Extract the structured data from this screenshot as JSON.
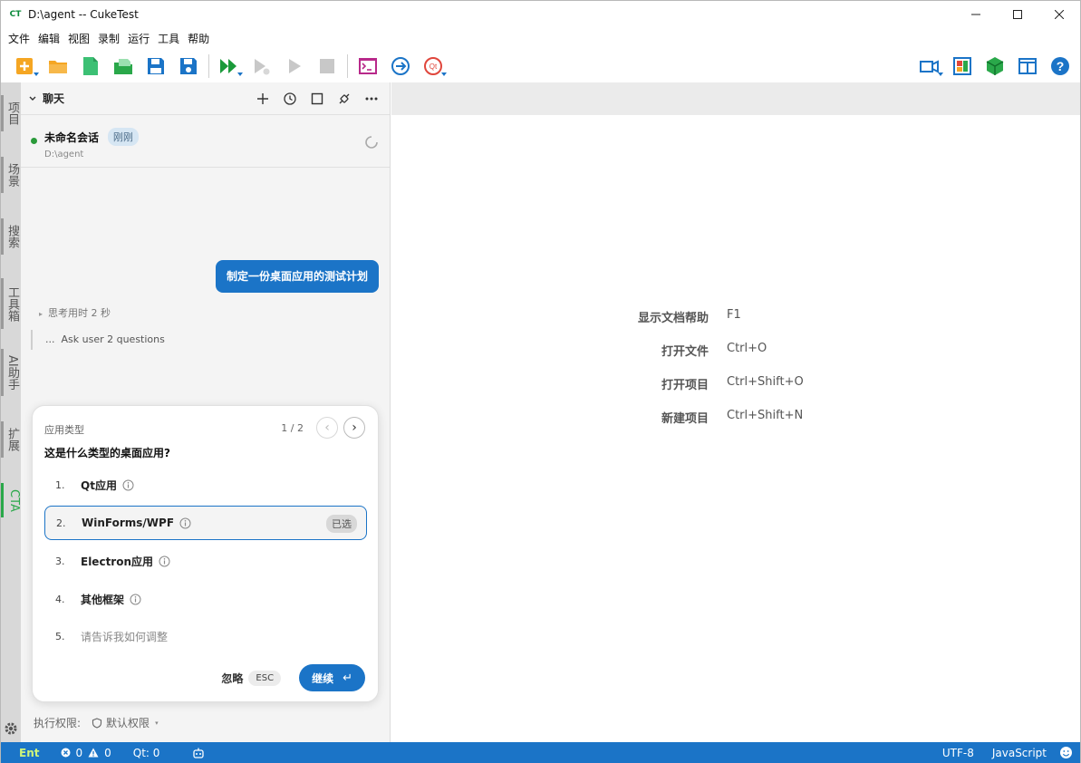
{
  "window": {
    "logo_text": "CT",
    "title": "D:\\agent -- CukeTest"
  },
  "menu": [
    "文件",
    "编辑",
    "视图",
    "录制",
    "运行",
    "工具",
    "帮助"
  ],
  "toolbar": {
    "icons": [
      "new-icon",
      "open-folder-icon",
      "new-file-icon",
      "open-file-icon",
      "save-icon",
      "save-all-icon",
      "run-all-icon",
      "run-config-icon",
      "run-icon",
      "stop-icon",
      "terminal-icon",
      "navigate-icon",
      "qt-icon"
    ],
    "right_icons": [
      "record-icon",
      "layout-icon",
      "package-icon",
      "panel-icon",
      "help-icon"
    ]
  },
  "side_tabs": [
    "项目",
    "场景",
    "搜索",
    "工具箱",
    "AI助手",
    "扩展",
    "CTA"
  ],
  "chat": {
    "title": "聊天",
    "session": {
      "name": "未命名会话",
      "badge": "刚刚",
      "path": "D:\\agent"
    },
    "user_message": "制定一份桌面应用的测试计划",
    "thinking": "思考用时 2 秒",
    "ask_ellipsis": "...",
    "ask": "Ask user 2 questions"
  },
  "question": {
    "type": "应用类型",
    "pager": "1 / 2",
    "prev": "‹",
    "next": "›",
    "title": "这是什么类型的桌面应用?",
    "options": [
      {
        "num": "1.",
        "label": "Qt应用",
        "selected": false
      },
      {
        "num": "2.",
        "label": "WinForms/WPF",
        "selected": true,
        "badge": "已选"
      },
      {
        "num": "3.",
        "label": "Electron应用",
        "selected": false
      },
      {
        "num": "4.",
        "label": "其他框架",
        "selected": false
      },
      {
        "num": "5.",
        "placeholder": "请告诉我如何调整"
      }
    ],
    "ignore": "忽略",
    "esc": "ESC",
    "continue": "继续",
    "enter_glyph": "↵"
  },
  "permission": {
    "label": "执行权限:",
    "value": "默认权限"
  },
  "editor_hints": [
    {
      "label": "显示文档帮助",
      "key": "F1"
    },
    {
      "label": "打开文件",
      "key": "Ctrl+O"
    },
    {
      "label": "打开项目",
      "key": "Ctrl+Shift+O"
    },
    {
      "label": "新建项目",
      "key": "Ctrl+Shift+N"
    }
  ],
  "status": {
    "ent": "Ent",
    "errors": "0",
    "warnings": "0",
    "qt": "Qt: 0",
    "encoding": "UTF-8",
    "language": "JavaScript"
  },
  "colors": {
    "accent": "#1b74c7",
    "success": "#2aa84a"
  }
}
